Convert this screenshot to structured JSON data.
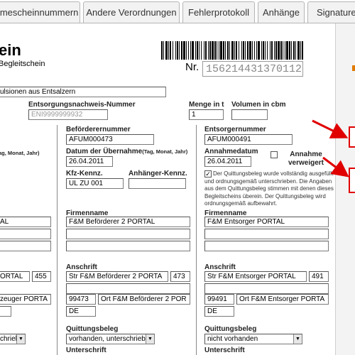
{
  "tabs": [
    "hmescheinnummern",
    "Andere Verordnungen",
    "Fehlerprotokoll",
    "Anhänge",
    "Signaturen"
  ],
  "header": {
    "title": "ein",
    "subtitle": "Begleitschein",
    "nr_label": "Nr.",
    "nr_value": "156214431370112"
  },
  "top": {
    "waste_desc": "ulsionen aus Entsalzern",
    "ent_nr_label": "Entsorgungsnachweis-Nummer",
    "ent_nr_value": "ENI9999999932",
    "menge_label": "Menge in t",
    "menge_value": "1",
    "volumen_label": "Volumen in cbm",
    "volumen_value": ""
  },
  "left": {
    "date_hint": "ag, Monat, Jahr)",
    "firm": "AL",
    "street": "ORTAL",
    "hnr": "455",
    "city": "zeuger PORTA",
    "beleg": "chrieb"
  },
  "mid": {
    "nr_label": "Beförderernummer",
    "nr_value": "AFUM000473",
    "date_label": "Datum der Übernahme",
    "date_hint": "(Tag, Monat, Jahr)",
    "date_value": "26.04.2011",
    "kfz_label": "Kfz-Kennz.",
    "kfz_value": "UL ZU 001",
    "anh_label": "Anhänger-Kennz.",
    "anh_value": "",
    "firm_label": "Firmenname",
    "firm_value": "F&M Beförderer 2 PORTAL",
    "addr_label": "Anschrift",
    "street_value": "Str F&M Beförderer 2 PORTA",
    "hnr_value": "473",
    "plz_value": "99473",
    "city_value": "Ort F&M Beförderer 2 POR",
    "country_value": "DE",
    "beleg_label": "Quittungsbeleg",
    "beleg_value": "vorhanden, unterschrieb",
    "sign_label": "Unterschrift"
  },
  "right": {
    "nr_label": "Entsorgernummer",
    "nr_value": "AFUM000491",
    "date_label": "Annahmedatum",
    "date_value": "26.04.2011",
    "refused_label": "Annahme verweigert",
    "note": "Der Quittungsbeleg wurde vollständig ausgefüllt und ordnungsgemäß unterschrieben. Die Angaben aus dem Quittungsbeleg stimmen mit denen dieses Begleitscheins überein. Der Quittungsbeleg wird ordnungsgemäß aufbewahrt.",
    "firm_label": "Firmenname",
    "firm_value": "F&M Entsorger PORTAL",
    "addr_label": "Anschrift",
    "street_value": "Str F&M Entsorger PORTAL",
    "hnr_value": "491",
    "plz_value": "99491",
    "city_value": "Ort F&M Entsorger PORTA",
    "country_value": "DE",
    "beleg_label": "Quittungsbeleg",
    "beleg_value": "nicht vorhanden",
    "sign_label": "Unterschrift"
  },
  "colors": {
    "annotation": "#e00000"
  }
}
